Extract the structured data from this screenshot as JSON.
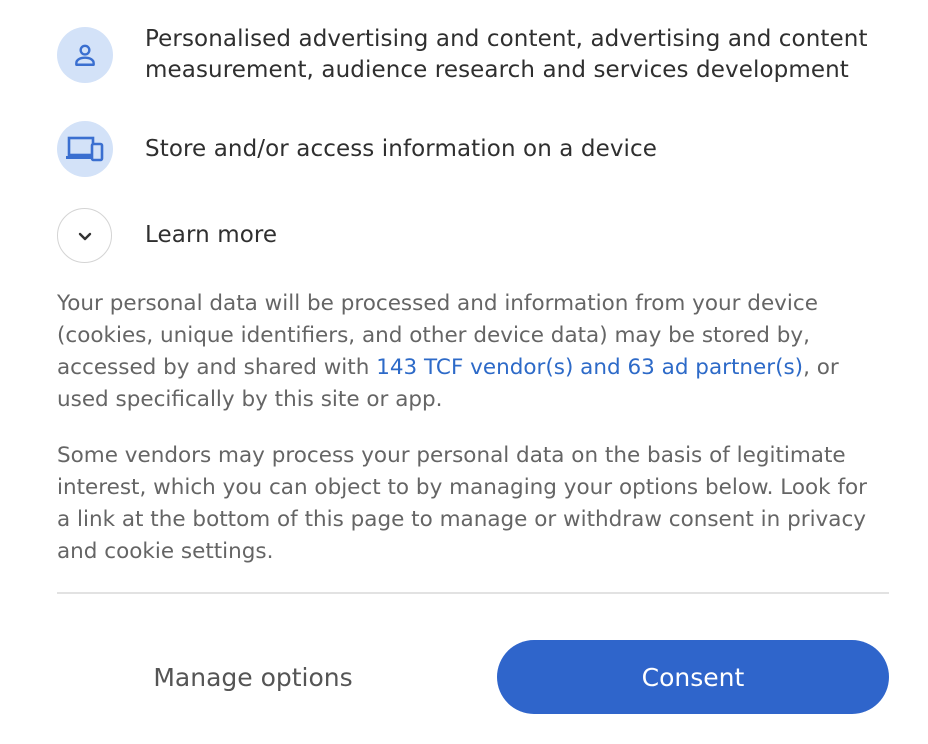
{
  "purposes": [
    {
      "icon": "person-icon",
      "text": "Personalised advertising and content, advertising and content measurement, audience research and services development"
    },
    {
      "icon": "devices-icon",
      "text": "Store and/or access information on a device"
    }
  ],
  "learn_more": {
    "icon": "chevron-down-icon",
    "label": "Learn more"
  },
  "paragraphs": {
    "p1_before_link": "Your personal data will be processed and information from your device (cookies, unique identifiers, and other device data) may be stored by, accessed by and shared with ",
    "p1_link": "143 TCF vendor(s) and 63 ad partner(s)",
    "p1_after_link": ", or used specifically by this site or app.",
    "p2": "Some vendors may process your personal data on the basis of legitimate interest, which you can object to by managing your options below. Look for a link at the bottom of this page to manage or withdraw consent in privacy and cookie settings."
  },
  "buttons": {
    "manage_label": "Manage options",
    "consent_label": "Consent"
  },
  "colors": {
    "accent": "#2f65cb",
    "icon_bg": "#d3e2f8",
    "icon_fg": "#3a6fd0",
    "link": "#2d6ac8"
  }
}
